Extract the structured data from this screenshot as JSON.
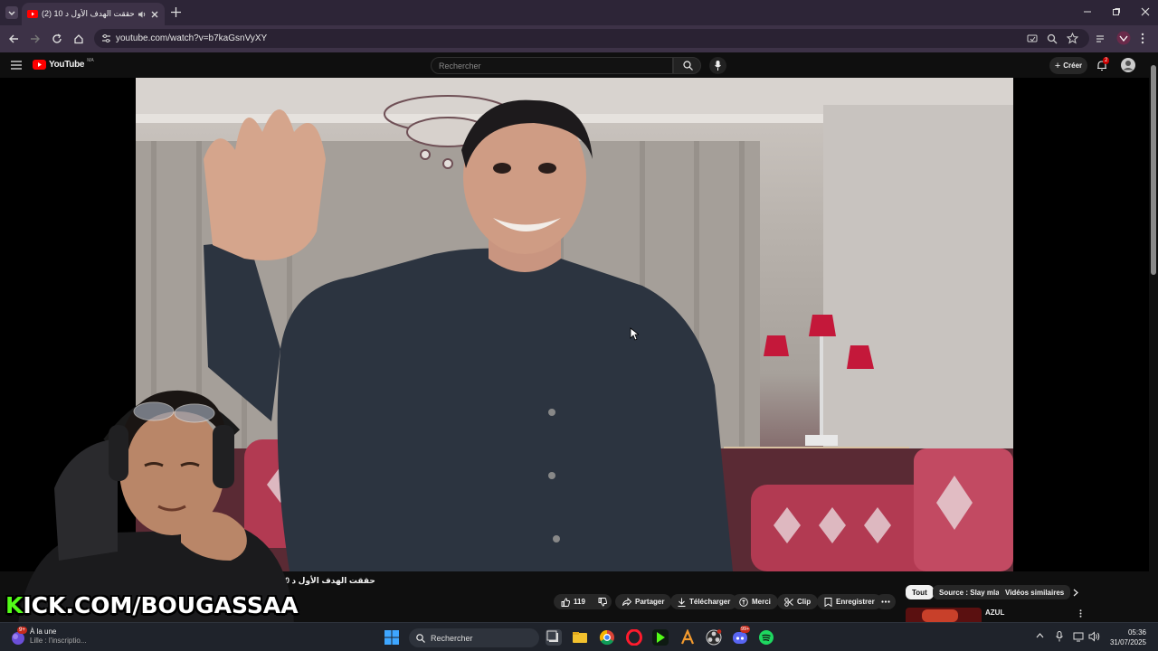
{
  "browser": {
    "tab_title": "(2) حققت الهدف الأول د 10",
    "url": "youtube.com/watch?v=b7kaGsnVyXY"
  },
  "youtube": {
    "logo_text": "YouTube",
    "logo_region": "MA",
    "search_placeholder": "Rechercher",
    "create_label": "Créer",
    "notification_count": "2"
  },
  "player": {
    "progress_fraction": 0.002
  },
  "video": {
    "title": "حققت الهدف الأول د 10",
    "like_count": "119",
    "share_label": "Partager",
    "download_label": "Télécharger",
    "thanks_label": "Merci",
    "clip_label": "Clip",
    "save_label": "Enregistrer"
  },
  "sidebar": {
    "chips": [
      "Tout",
      "Source : Slay mlay",
      "Vidéos similaires"
    ],
    "next_item_title": "AZUL"
  },
  "overlay": {
    "kick_text": "KICK.COM/BOUGASSAA"
  },
  "taskbar": {
    "news_badge": "9+",
    "news_title": "À la une",
    "news_sub": "Lille : l'inscriptio...",
    "search_label": "Rechercher",
    "discord_badge": "99+",
    "time": "05:36",
    "date": "31/07/2025"
  },
  "colors": {
    "youtube_red": "#ff0000",
    "kick_green": "#53fc18",
    "chrome_bg": "#2d2537"
  }
}
